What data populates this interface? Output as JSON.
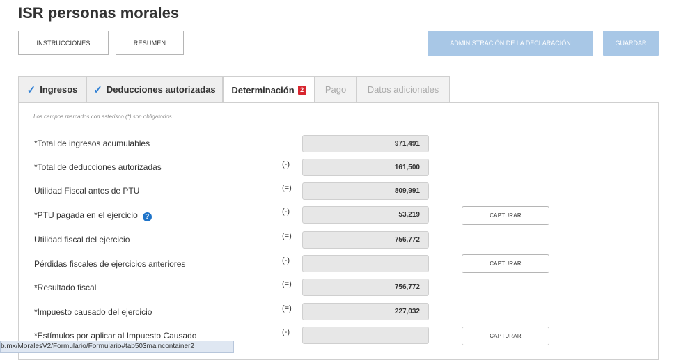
{
  "page": {
    "title": "ISR personas morales"
  },
  "toolbar": {
    "instructions_label": "INSTRUCCIONES",
    "summary_label": "RESUMEN",
    "admin_label": "ADMINISTRACIÓN DE LA DECLARACIÓN",
    "save_label": "GUARDAR"
  },
  "tabs": [
    {
      "label": "Ingresos",
      "state": "completed"
    },
    {
      "label": "Deducciones autorizadas",
      "state": "completed"
    },
    {
      "label": "Determinación",
      "state": "active",
      "badge": "2"
    },
    {
      "label": "Pago",
      "state": "disabled"
    },
    {
      "label": "Datos adicionales",
      "state": "disabled"
    }
  ],
  "form": {
    "hint": "Los campos marcados con asterisco (*) son obligatorios",
    "capture_label": "CAPTURAR",
    "help_icon": "?",
    "rows": [
      {
        "label": "*Total de ingresos acumulables",
        "operator": "",
        "value": "971,491"
      },
      {
        "label": "*Total de deducciones autorizadas",
        "operator": "(-)",
        "value": "161,500"
      },
      {
        "label": "Utilidad Fiscal antes de PTU",
        "operator": "(=)",
        "value": "809,991"
      },
      {
        "label": "*PTU pagada en el ejercicio",
        "operator": "(-)",
        "value": "53,219"
      },
      {
        "label": "Utilidad fiscal del ejercicio",
        "operator": "(=)",
        "value": "756,772"
      },
      {
        "label": "Pérdidas fiscales de ejercicios anteriores",
        "operator": "(-)",
        "value": ""
      },
      {
        "label": "*Resultado fiscal",
        "operator": "(=)",
        "value": "756,772"
      },
      {
        "label": "*Impuesto causado del ejercicio",
        "operator": "(=)",
        "value": "227,032"
      },
      {
        "label": "*Estímulos por aplicar al Impuesto Causado",
        "operator": "(-)",
        "value": ""
      }
    ]
  },
  "status_bar": {
    "url": "b.mx/MoralesV2/Formulario/Formulario#tab503maincontainer2"
  },
  "colors": {
    "accent": "#2e7fd4",
    "primary_disabled": "#a8c7e6",
    "badge": "#d8262f"
  },
  "icons": {
    "completed_tab": "check-icon",
    "help": "question-circle-icon"
  }
}
